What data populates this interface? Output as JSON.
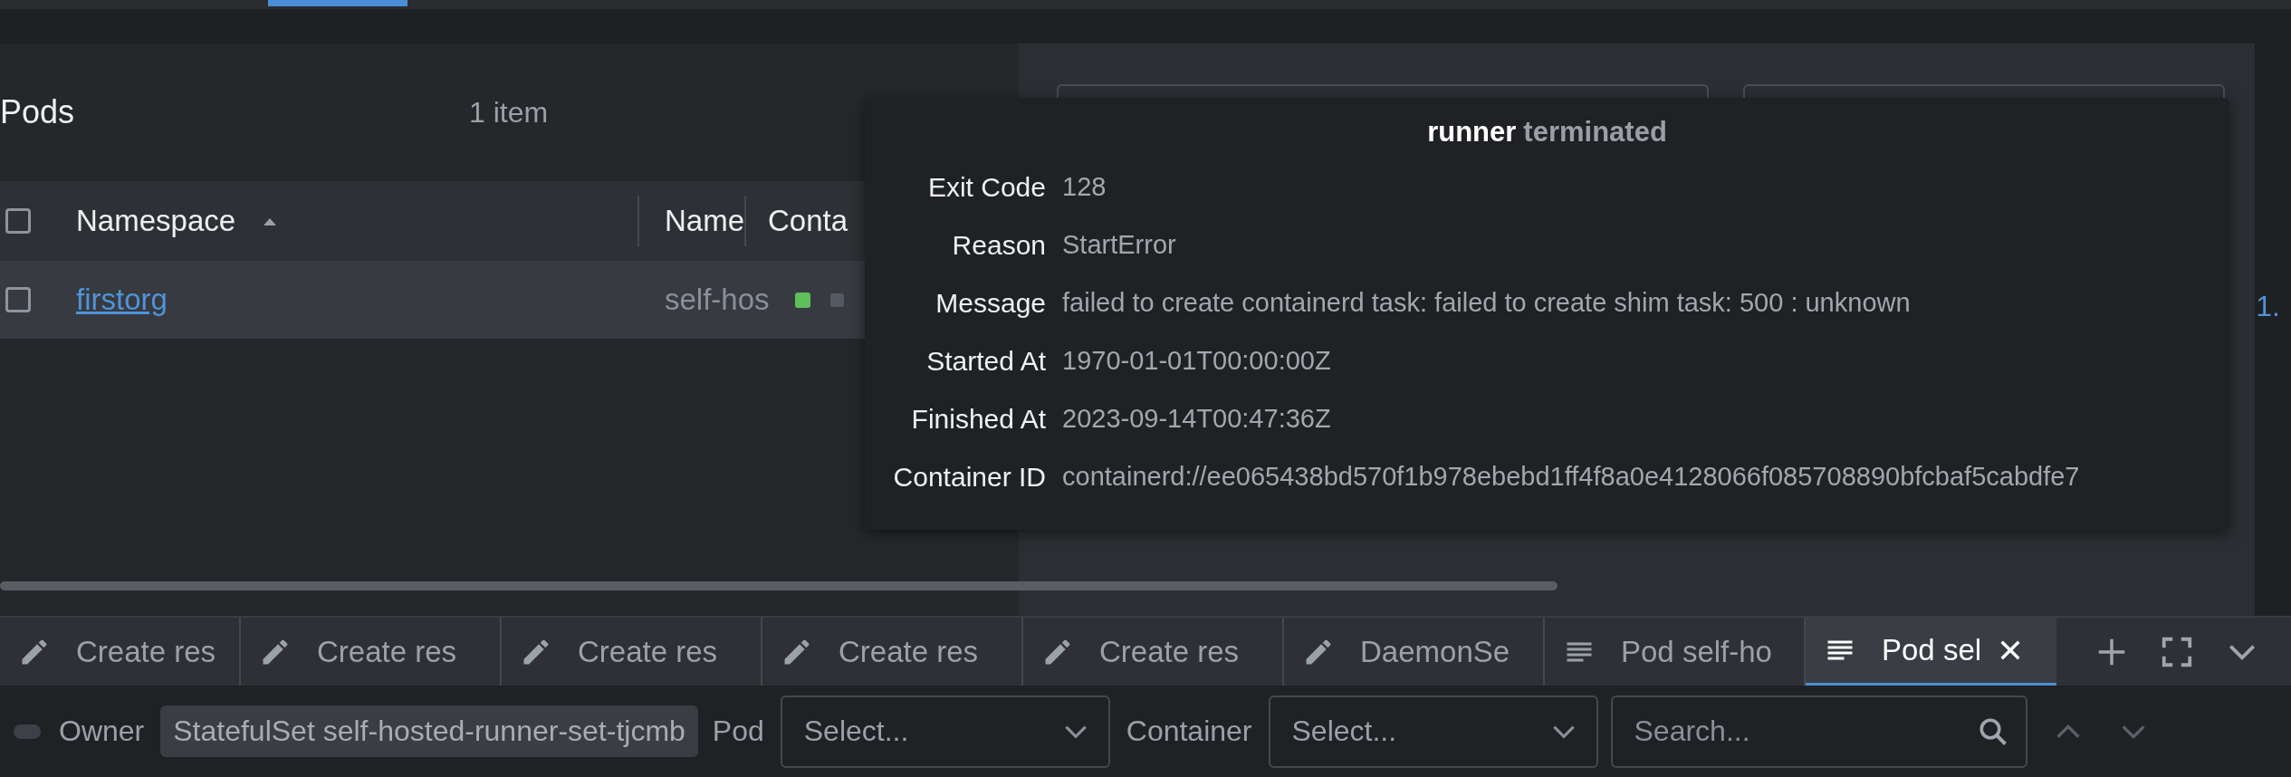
{
  "pods": {
    "title": "Pods",
    "count": "1 item",
    "columns": [
      {
        "label": "Namespace",
        "sorted": true
      },
      {
        "label": "Name",
        "sorted": false
      },
      {
        "label": "Conta",
        "sorted": false
      }
    ],
    "rows": [
      {
        "checked": false,
        "namespace": "firstorg",
        "name": "self-hos",
        "containers": [
          {
            "color": "#5fbf5a"
          },
          {
            "color": "#555961"
          }
        ]
      }
    ],
    "header_checked": false
  },
  "details": {
    "link_fragment": "1."
  },
  "tooltip": {
    "container": "runner",
    "state": "terminated",
    "fields": [
      {
        "label": "Exit Code",
        "value": "128"
      },
      {
        "label": "Reason",
        "value": "StartError"
      },
      {
        "label": "Message",
        "value": "failed to create containerd task: failed to create shim task: 500 : unknown"
      },
      {
        "label": "Started At",
        "value": "1970-01-01T00:00:00Z"
      },
      {
        "label": "Finished At",
        "value": "2023-09-14T00:47:36Z"
      },
      {
        "label": "Container ID",
        "value": "containerd://ee065438bd570f1b978ebebd1ff4f8a0e4128066f085708890bfcbaf5cabdfe7"
      }
    ]
  },
  "dock_tabs": [
    {
      "kind": "edit",
      "label": "Create res",
      "selected": false
    },
    {
      "kind": "edit",
      "label": "Create res",
      "selected": false
    },
    {
      "kind": "edit",
      "label": "Create res",
      "selected": false
    },
    {
      "kind": "edit",
      "label": "Create res",
      "selected": false
    },
    {
      "kind": "edit",
      "label": "Create res",
      "selected": false
    },
    {
      "kind": "edit",
      "label": "DaemonSe",
      "selected": false
    },
    {
      "kind": "logs",
      "label": "Pod self-ho",
      "selected": false
    },
    {
      "kind": "logs",
      "label": "Pod sel",
      "selected": true
    }
  ],
  "log_toolbar": {
    "owner_toggle_on": false,
    "owner_label": "Owner",
    "owner_value": "StatefulSet self-hosted-runner-set-tjcmb",
    "pod_label": "Pod",
    "pod_placeholder": "Select...",
    "container_label": "Container",
    "container_placeholder": "Select...",
    "search_placeholder": "Search..."
  }
}
